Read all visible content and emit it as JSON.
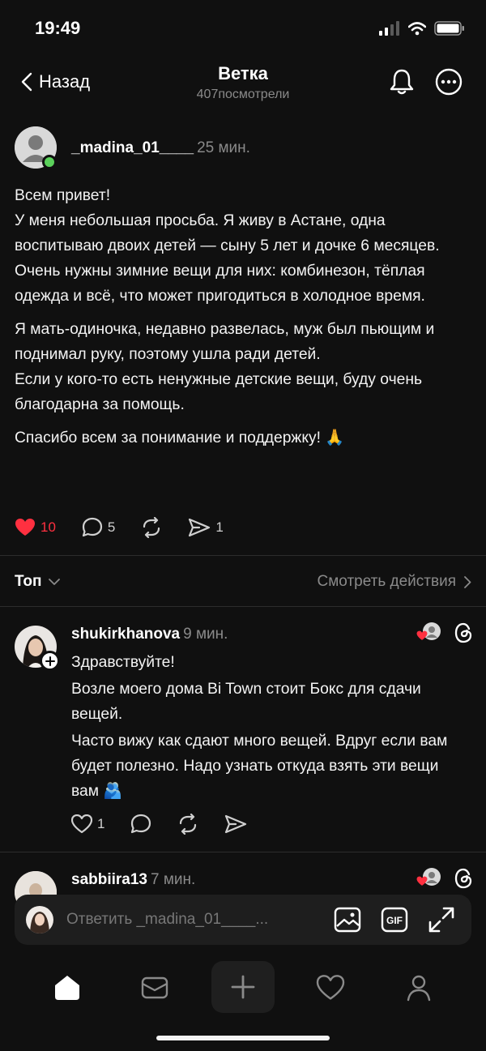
{
  "status": {
    "time": "19:49"
  },
  "header": {
    "back_label": "Назад",
    "title": "Ветка",
    "views_count": "407",
    "views_label": "посмотрели"
  },
  "post": {
    "author": "_madina_01____",
    "time": "25 мин.",
    "paragraphs": [
      "Всем привет!",
      "У меня небольшая просьба. Я живу в Астане, одна воспитываю двоих детей — сыну 5 лет и дочке 6 месяцев.",
      "Очень нужны зимние вещи для них: комбинезон, тёплая одежда и всё, что может пригодиться в холодное время.",
      "Я мать-одиночка, недавно развелась, муж был пьющим и поднимал руку, поэтому ушла ради детей.",
      "Если у кого-то есть ненужные детские вещи, буду очень благодарна за помощь.",
      "Спасибо всем за понимание и поддержку! 🙏"
    ],
    "likes": "10",
    "comments": "5",
    "shares": "1"
  },
  "sort": {
    "label": "Топ",
    "activity_link": "Смотреть действия"
  },
  "comments": [
    {
      "author": "shukirkhanova",
      "time": "9 мин.",
      "paragraphs": [
        "Здравствуйте!",
        "Возле моего дома Bi Town стоит Бокс  для сдачи вещей.",
        "Часто вижу как сдают много вещей. Вдруг если вам будет полезно. Надо узнать откуда взять эти вещи вам 🫂"
      ],
      "likes": "1"
    },
    {
      "author": "sabbiira13",
      "time": "7 мин."
    }
  ],
  "reply": {
    "placeholder": "Ответить _madina_01____..."
  },
  "colors": {
    "background": "#101010",
    "like_red": "#ff3040",
    "online_green": "#5bd15b",
    "muted": "#8a8a8a"
  }
}
